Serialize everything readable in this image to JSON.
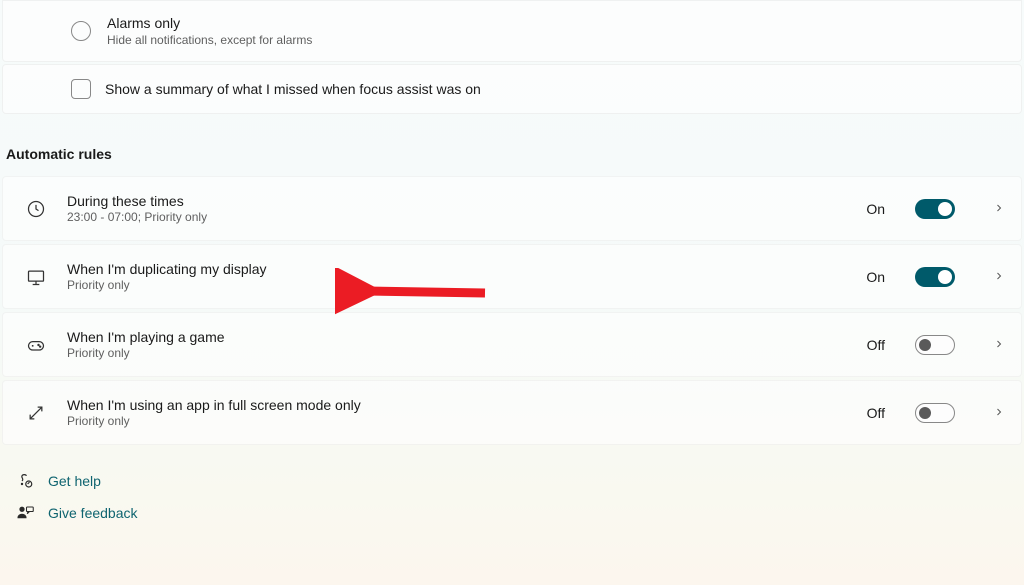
{
  "options": {
    "alarms_only": {
      "title": "Alarms only",
      "description": "Hide all notifications, except for alarms"
    },
    "show_summary": {
      "label": "Show a summary of what I missed when focus assist was on"
    }
  },
  "section_title": "Automatic rules",
  "rules": [
    {
      "title": "During these times",
      "subtitle": "23:00 - 07:00; Priority only",
      "state_label": "On",
      "on": true
    },
    {
      "title": "When I'm duplicating my display",
      "subtitle": "Priority only",
      "state_label": "On",
      "on": true
    },
    {
      "title": "When I'm playing a game",
      "subtitle": "Priority only",
      "state_label": "Off",
      "on": false
    },
    {
      "title": "When I'm using an app in full screen mode only",
      "subtitle": "Priority only",
      "state_label": "Off",
      "on": false
    }
  ],
  "links": {
    "get_help": "Get help",
    "give_feedback": "Give feedback"
  },
  "colors": {
    "accent": "#005a6a",
    "link": "#0f6470"
  }
}
